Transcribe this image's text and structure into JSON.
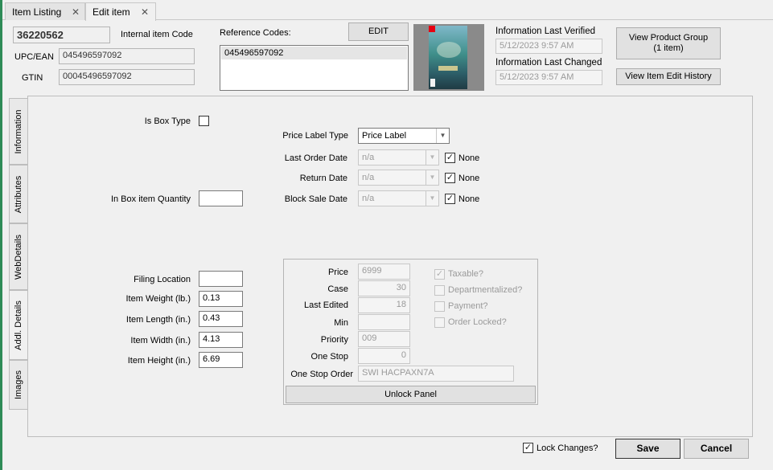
{
  "tabs": [
    {
      "label": "Item Listing",
      "close": "✕"
    },
    {
      "label": "Edit item",
      "close": "✕"
    }
  ],
  "header": {
    "item_number": "36220562",
    "internal_code_label": "Internal item Code",
    "upc_label": "UPC/EAN",
    "upc_value": "045496597092",
    "gtin_label": "GTIN",
    "gtin_value": "00045496597092",
    "ref_codes_label": "Reference Codes:",
    "ref_codes": [
      "045496597092"
    ],
    "edit_button": "EDIT",
    "info_verified_label": "Information Last Verified",
    "info_verified_value": "5/12/2023 9:57 AM",
    "info_changed_label": "Information Last Changed",
    "info_changed_value": "5/12/2023 9:57 AM",
    "view_group_button_line1": "View Product Group",
    "view_group_button_line2": "(1 item)",
    "view_history_button": "View Item Edit History"
  },
  "side_tabs": [
    "Information",
    "Attributes",
    "WebDetails",
    "Addl. Details",
    "Images"
  ],
  "addl": {
    "is_box_type_label": "Is Box Type",
    "is_box_type_checked": false,
    "in_box_qty_label": "In Box item Quantity",
    "in_box_qty_value": "",
    "price_label_type_label": "Price Label Type",
    "price_label_type_value": "Price Label",
    "last_order_date_label": "Last Order Date",
    "return_date_label": "Return Date",
    "block_sale_date_label": "Block Sale Date",
    "date_placeholder": "n/a",
    "none_label": "None",
    "filing_location_label": "Filing Location",
    "filing_location_value": "",
    "weight_label": "Item Weight (lb.)",
    "weight_value": "0.13",
    "length_label": "Item Length (in.)",
    "length_value": "0.43",
    "width_label": "Item Width (in.)",
    "width_value": "4.13",
    "height_label": "Item Height (in.)",
    "height_value": "6.69"
  },
  "panel": {
    "price_label": "Price",
    "price_value": "6999",
    "case_label": "Case",
    "case_value": "30",
    "last_edited_label": "Last Edited",
    "last_edited_value": "18",
    "min_label": "Min",
    "min_value": "",
    "priority_label": "Priority",
    "priority_value": "009",
    "one_stop_label": "One Stop",
    "one_stop_value": "0",
    "one_stop_order_label": "One Stop Order",
    "one_stop_order_value": "SWI HACPAXN7A",
    "taxable_label": "Taxable?",
    "taxable_checked": true,
    "departmentalized_label": "Departmentalized?",
    "payment_label": "Payment?",
    "order_locked_label": "Order Locked?",
    "unlock_button": "Unlock Panel"
  },
  "footer": {
    "lock_changes_label": "Lock Changes?",
    "lock_changes_checked": true,
    "save_button": "Save",
    "cancel_button": "Cancel"
  },
  "checkmark": "✓",
  "dropdown_arrow": "▼",
  "colors": {
    "accent_left_bar": "#2e8b57",
    "cover_teal": "#3f8f8a",
    "switch_red": "#e60012"
  }
}
